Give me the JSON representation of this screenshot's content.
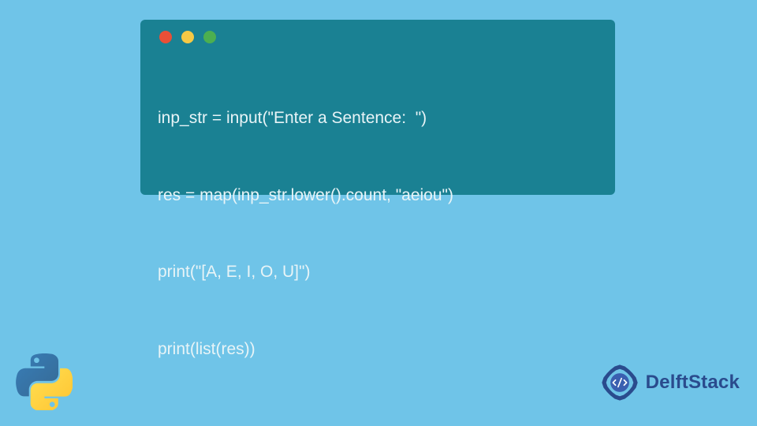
{
  "code": {
    "lines": [
      "inp_str = input(\"Enter a Sentence:  \")",
      "res = map(inp_str.lower().count, \"aeiou\")",
      "print(\"[A, E, I, O, U]\")",
      "print(list(res))"
    ]
  },
  "traffic_lights": {
    "red": "close-icon",
    "yellow": "minimize-icon",
    "green": "maximize-icon"
  },
  "branding": {
    "delft_text": "DelftStack"
  }
}
